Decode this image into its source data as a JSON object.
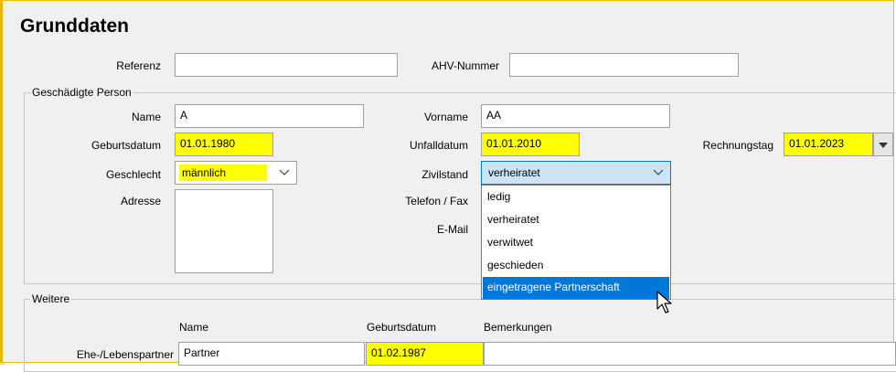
{
  "title": "Grunddaten",
  "referenz": {
    "label": "Referenz",
    "value": ""
  },
  "ahv": {
    "label": "AHV-Nummer",
    "value": ""
  },
  "person_group": {
    "title": "Geschädigte Person",
    "name": {
      "label": "Name",
      "value": "A"
    },
    "vorname": {
      "label": "Vorname",
      "value": "AA"
    },
    "geburtsdatum": {
      "label": "Geburtsdatum",
      "value": "01.01.1980"
    },
    "unfalldatum": {
      "label": "Unfalldatum",
      "value": "01.01.2010"
    },
    "rechnungstag": {
      "label": "Rechnungstag",
      "value": "01.01.2023"
    },
    "geschlecht": {
      "label": "Geschlecht",
      "value": "männlich"
    },
    "zivilstand": {
      "label": "Zivilstand",
      "value": "verheiratet",
      "options": [
        "ledig",
        "verheiratet",
        "verwitwet",
        "geschieden",
        "eingetragene Partnerschaft"
      ],
      "highlighted": "eingetragene Partnerschaft"
    },
    "adresse": {
      "label": "Adresse",
      "value": ""
    },
    "telefon": {
      "label": "Telefon / Fax"
    },
    "email": {
      "label": "E-Mail"
    }
  },
  "weitere_group": {
    "title": "Weitere",
    "columns": [
      "Name",
      "Geburtsdatum",
      "Bemerkungen"
    ],
    "rows": [
      {
        "label": "Ehe-/Lebenspartner",
        "name": "Partner",
        "geburtsdatum": "01.02.1987",
        "bemerkungen": ""
      }
    ]
  },
  "colors": {
    "highlight_field": "#ffff00",
    "selection": "#0078d7",
    "combo_open": "#cce4f7"
  },
  "icons": {
    "combo_arrow": "chevron-down-icon",
    "cursor": "mouse-pointer-icon"
  }
}
